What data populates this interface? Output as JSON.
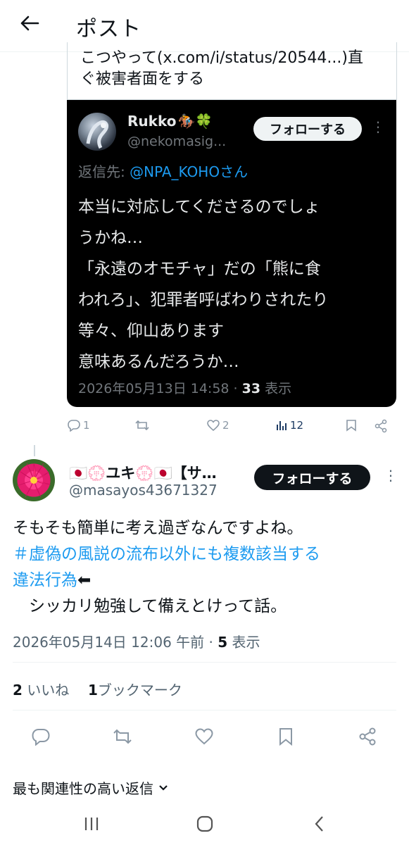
{
  "header": {
    "title": "ポスト"
  },
  "quoted": {
    "text_line1": "こつやって(x.com/i/status/20544...)直",
    "text_line2": "ぐ被害者面をする"
  },
  "embedded": {
    "name": "Rukko",
    "name_emoji": "🏇🍀",
    "handle": "@nekomasig...",
    "follow_label": "フォローする",
    "reply_prefix": "返信先: ",
    "reply_mention": "@NPA_KOHOさん",
    "body": [
      "本当に対応してくださるのでしょ",
      "うかね…",
      "「永遠のオモチャ」だの「熊に食",
      "われろ」、犯罪者呼ばわりされたり",
      "等々、仰山あります",
      "意味あるんだろうか…"
    ],
    "timestamp": "2026年05月13日 14:58 · ",
    "views_count": "33",
    "views_label": " 表示"
  },
  "mini_actions": {
    "replies": "1",
    "likes": "2",
    "views": "12"
  },
  "post": {
    "author_name": "🇯🇵💮ユキ💮🇯🇵【サ…",
    "author_handle": "@masayos43671327",
    "follow_label": "フォローする",
    "line1": "そもそも簡単に考え過ぎなんですよね。",
    "hashtag_line1": "＃虚偽の風説の流布以外にも複数該当する",
    "hashtag_line2": "違法行為",
    "arrow": "⬅",
    "line3": "　シッカリ勉強して備えとけって話。",
    "timestamp": "2026年05月14日 12:06 午前 · ",
    "views_count": "5",
    "views_label": " 表示"
  },
  "stats": {
    "likes_count": "2",
    "likes_label": " いいね",
    "bookmarks_count": "1",
    "bookmarks_label": "ブックマーク"
  },
  "relevant_replies": {
    "label": "最も関連性の高い返信"
  },
  "colors": {
    "link": "#1d9bf0",
    "dark_bg": "#000000",
    "follow_dark": "#0f1419",
    "muted": "#536471"
  }
}
